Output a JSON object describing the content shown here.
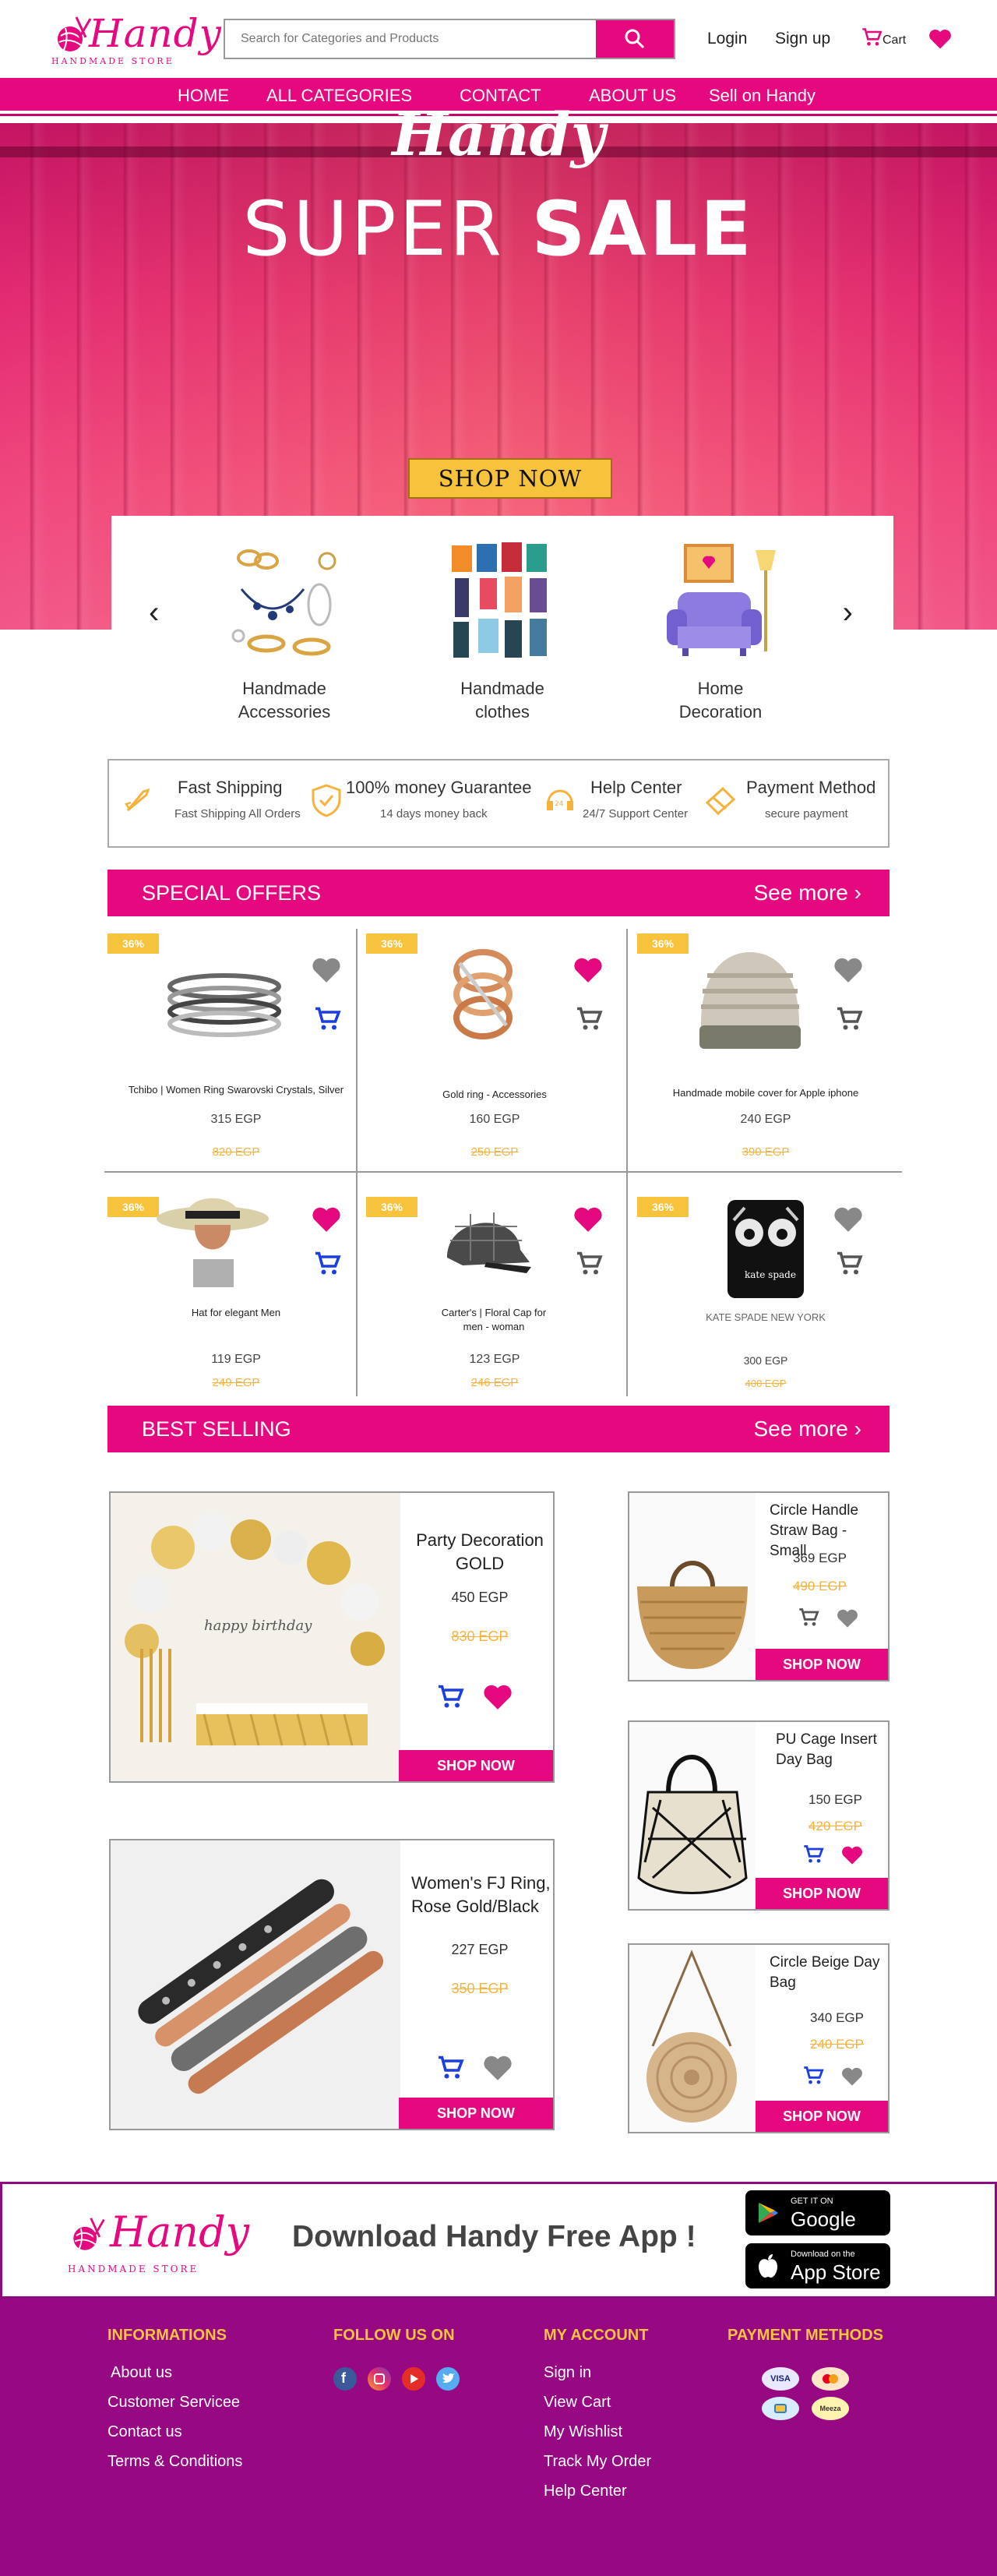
{
  "brand": {
    "name": "Handy",
    "tagline": "HANDMADE STORE"
  },
  "header": {
    "search_placeholder": "Search for Categories and Products",
    "login": "Login",
    "signup": "Sign up",
    "cart": "Cart"
  },
  "nav": {
    "items": [
      "HOME",
      "ALL CATEGORIES",
      "CONTACT",
      "ABOUT US",
      "Sell on Handy"
    ]
  },
  "hero": {
    "script": "Handy",
    "title_a": "SUPER",
    "title_b": "SALE",
    "cta": "SHOP NOW"
  },
  "categories": [
    {
      "label1": "Handmade",
      "label2": "Accessories",
      "icon": "jewelry-icon"
    },
    {
      "label1": "Handmade",
      "label2": "clothes",
      "icon": "clothes-icon"
    },
    {
      "label1": "Home",
      "label2": "Decoration",
      "icon": "armchair-icon"
    }
  ],
  "features": [
    {
      "title": "Fast Shipping",
      "sub": "Fast Shipping All Orders",
      "icon": "rocket-icon"
    },
    {
      "title": "100% money Guarantee",
      "sub": "14 days money back",
      "icon": "shield-icon"
    },
    {
      "title": "Help Center",
      "sub": "24/7 Support Center",
      "icon": "headset-icon"
    },
    {
      "title": "Payment Method",
      "sub": "secure payment",
      "icon": "credit-card-icon"
    }
  ],
  "special_offers": {
    "title": "SPECIAL OFFERS",
    "see_more": "See more",
    "items": [
      {
        "badge": "36%",
        "name": "Tchibo | Women Ring Swarovski Crystals, Silver",
        "price": "315 EGP",
        "old": "820 EGP",
        "liked": false
      },
      {
        "badge": "36%",
        "name": "Gold ring - Accessories",
        "price": "160 EGP",
        "old": "250 EGP",
        "liked": true
      },
      {
        "badge": "36%",
        "name": "Handmade mobile cover for Apple iphone",
        "price": "240 EGP",
        "old": "390 EGP",
        "liked": false
      },
      {
        "badge": "36%",
        "name": "Hat for elegant Men",
        "price": "119 EGP",
        "old": "249 EGP",
        "liked": true
      },
      {
        "badge": "36%",
        "name": "Carter's | Floral Cap for men - woman",
        "price": "123 EGP",
        "old": "246 EGP",
        "liked": true
      },
      {
        "badge": "36%",
        "name": "KATE SPADE NEW YORK",
        "price": "300  EGP",
        "old": "400 EGP",
        "liked": false
      }
    ]
  },
  "best_selling": {
    "title": "BEST SELLING",
    "see_more": "See more",
    "shop_label": "SHOP NOW",
    "large": [
      {
        "name": "Party Decoration GOLD",
        "price": "450 EGP",
        "old": "830 EGP"
      },
      {
        "name": "Women's FJ Ring, Rose Gold/Black",
        "price": "227 EGP",
        "old": "350 EGP"
      }
    ],
    "small": [
      {
        "name": "Circle Handle Straw Bag - Small",
        "price": "369 EGP",
        "old": "490 EGP"
      },
      {
        "name": "PU Cage Insert Day Bag",
        "price": "150 EGP",
        "old": "420 EGP"
      },
      {
        "name": "Circle Beige Day Bag",
        "price": "340 EGP",
        "old": "240 EGP"
      }
    ]
  },
  "app": {
    "copy": "Download Handy Free App !",
    "google_small": "GET IT ON",
    "google_big": "Google Play",
    "apple_small": "Download on the",
    "apple_big": "App Store"
  },
  "footer": {
    "info_title": "INFORMATIONS",
    "info_links": [
      "About us",
      "Customer Servicee",
      "Contact us",
      "Terms & Conditions"
    ],
    "follow_title": "FOLLOW US ON",
    "account_title": "MY ACCOUNT",
    "account_links": [
      "Sign in",
      "View Cart",
      "My Wishlist",
      "Track My Order",
      "Help Center"
    ],
    "payment_title": "PAYMENT METHODS",
    "payment_labels": [
      "VISA",
      "Meeza"
    ]
  },
  "colors": {
    "brand_pink": "#e6087f",
    "accent_yellow": "#f7c33c",
    "footer_purple": "#970982",
    "cart_blue": "#1a3fe0"
  }
}
